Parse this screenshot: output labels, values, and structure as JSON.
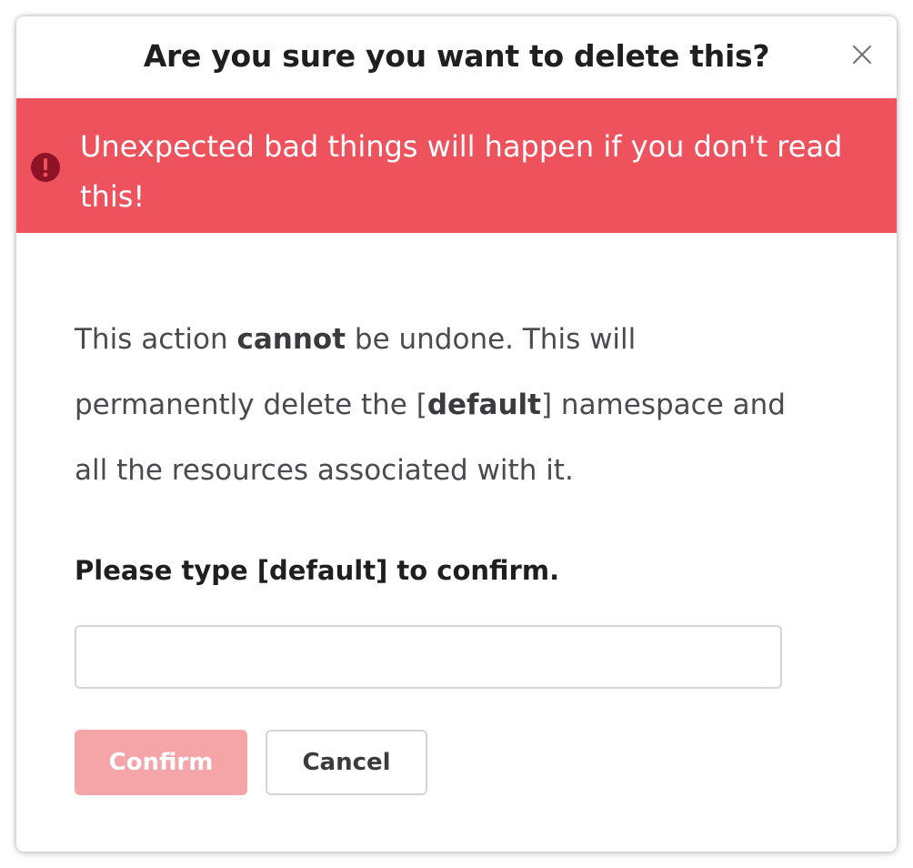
{
  "dialog": {
    "title": "Are you sure you want to delete this?",
    "close_icon": "close-icon"
  },
  "alert": {
    "icon": "error-circle-icon",
    "message": "Unexpected bad things will happen if you don't read this!",
    "background_color": "#ee535d"
  },
  "body": {
    "part1": "This action ",
    "bold1": "cannot",
    "part2": " be undone. This will permanently delete the [",
    "bold2": "default",
    "part3": "] namespace and all the resources associated with it."
  },
  "confirm": {
    "label": "Please type [default] to confirm.",
    "input_value": "",
    "input_placeholder": ""
  },
  "buttons": {
    "confirm_label": "Confirm",
    "cancel_label": "Cancel",
    "confirm_color": "#f5a4a8"
  }
}
